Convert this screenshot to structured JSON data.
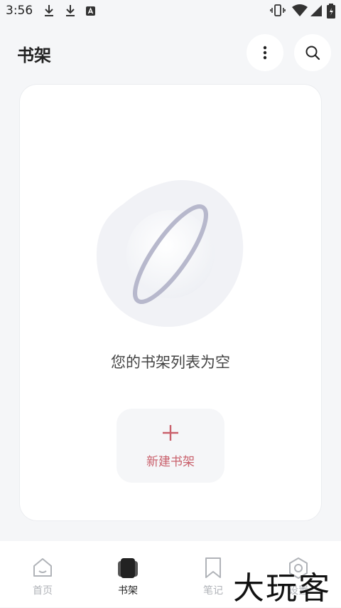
{
  "status_bar": {
    "time": "3:56"
  },
  "header": {
    "title": "书架"
  },
  "empty_state": {
    "message": "您的书架列表为空"
  },
  "new_shelf_button": {
    "label": "新建书架"
  },
  "tabs": [
    {
      "label": "首页",
      "icon": "home-icon",
      "active": false
    },
    {
      "label": "书架",
      "icon": "bookshelf-icon",
      "active": true
    },
    {
      "label": "笔记",
      "icon": "bookmark-icon",
      "active": false
    },
    {
      "label": "设置",
      "icon": "settings-icon",
      "active": false
    }
  ],
  "watermark": {
    "text": "大玩客"
  },
  "colors": {
    "accent": "#c9606b",
    "background": "#f5f6f8",
    "card": "#ffffff"
  }
}
